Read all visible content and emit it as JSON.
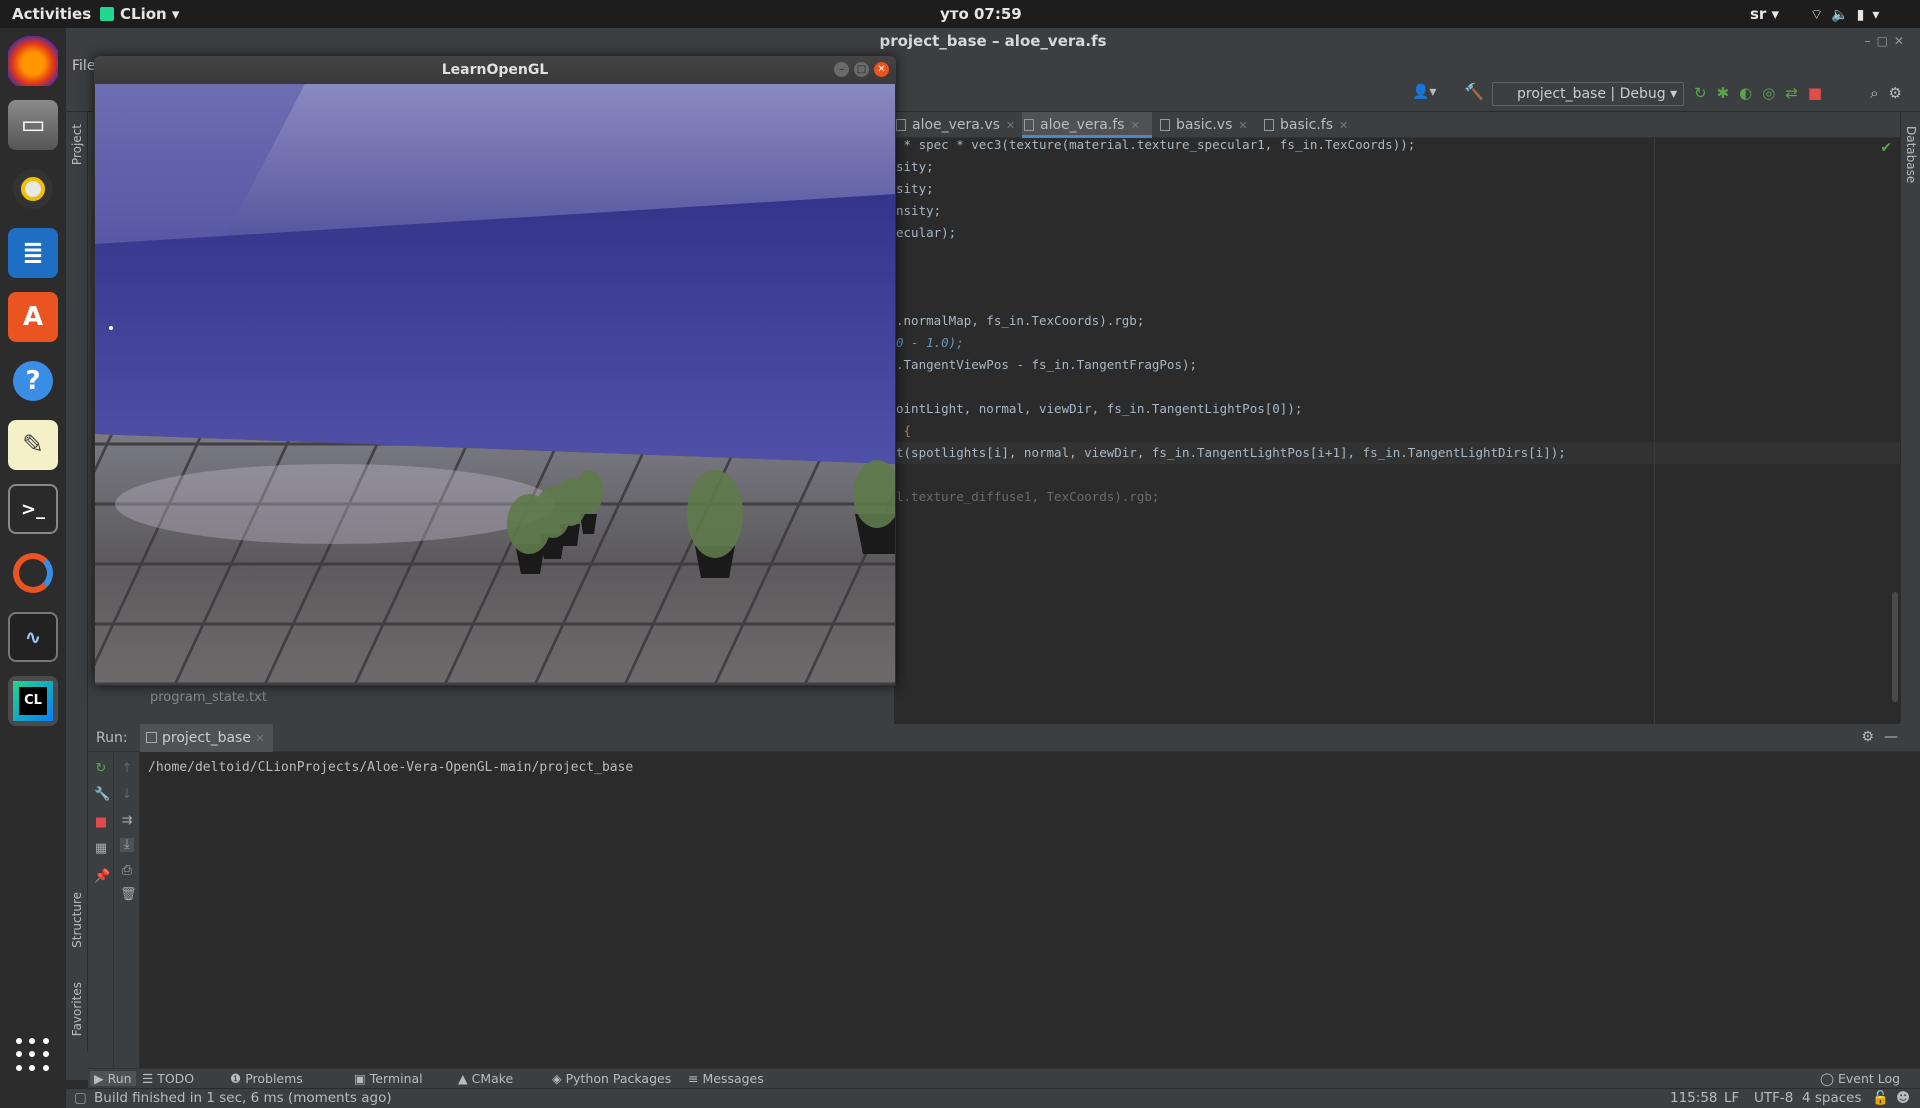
{
  "topbar": {
    "activities": "Activities",
    "app_name": "CLion",
    "clock": "уто 07:59",
    "keyboard": "sr"
  },
  "dock": {
    "items": [
      "firefox-icon",
      "files-icon",
      "rhythmbox-icon",
      "writer-icon",
      "software-icon",
      "help-icon",
      "text-editor-icon",
      "terminal-icon",
      "updater-icon",
      "system-monitor-icon",
      "clion-icon"
    ]
  },
  "ide": {
    "title": "project_base – aloe_vera.fs",
    "menu_file": "File",
    "run_config": "project_base | Debug",
    "left_tools": {
      "project": "Project",
      "structure": "Structure",
      "favorites": "Favorites"
    },
    "right_tools": {
      "database": "Database"
    },
    "tabs": [
      {
        "label": "aloe_vera.vs"
      },
      {
        "label": "aloe_vera.fs"
      },
      {
        "label": "basic.vs"
      },
      {
        "label": "basic.fs"
      }
    ],
    "code_lines": [
      " * spec * vec3(texture(material.texture_specular1, fs_in.TexCoords));",
      "sity;",
      "sity;",
      "nsity;",
      "ecular);",
      "",
      "",
      "",
      ".normalMap, fs_in.TexCoords).rgb;",
      "0 - 1.0);",
      ".TangentViewPos - fs_in.TangentFragPos);",
      "",
      "ointLight, normal, viewDir, fs_in.TangentLightPos[0]);",
      " {",
      "t(spotlights[i], normal, viewDir, fs_in.TangentLightPos[i+1], fs_in.TangentLightDirs[i]);",
      "",
      "l.texture_diffuse1, TexCoords).rgb;"
    ],
    "hidden_file": "program_state.txt"
  },
  "ogl_window": {
    "title": "LearnOpenGL"
  },
  "run_panel": {
    "label": "Run:",
    "tab": "project_base",
    "console_output": "/home/deltoid/CLionProjects/Aloe-Vera-OpenGL-main/project_base"
  },
  "bottom_tools": {
    "run": "Run",
    "todo": "TODO",
    "problems": "Problems",
    "terminal": "Terminal",
    "cmake": "CMake",
    "python_packages": "Python Packages",
    "messages": "Messages",
    "event_log": "Event Log"
  },
  "status": {
    "message": "Build finished in 1 sec, 6 ms (moments ago)",
    "position": "115:58",
    "line_sep": "LF",
    "encoding": "UTF-8",
    "indent": "4 spaces"
  },
  "colors": {
    "accent": "#4a88c7",
    "ubuntu_orange": "#e95420",
    "run_green": "#57a64a",
    "stop_red": "#e04c4c"
  }
}
